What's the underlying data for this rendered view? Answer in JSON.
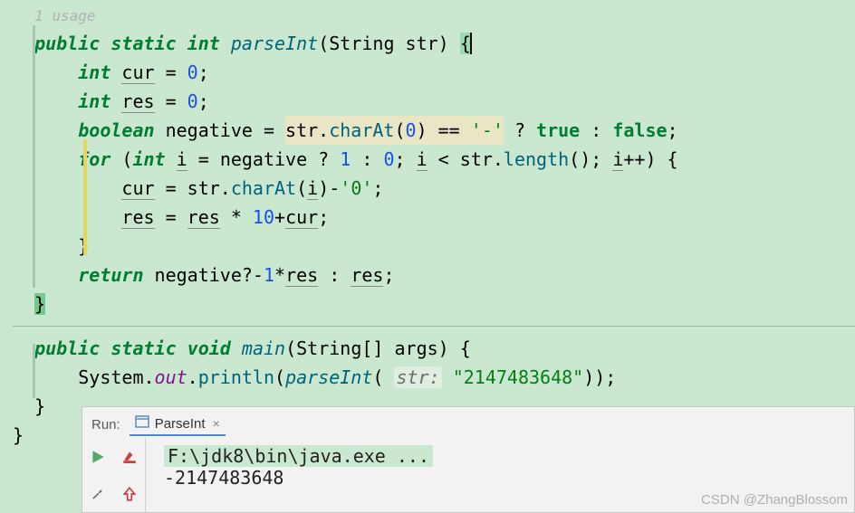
{
  "code": {
    "usage_hint": "1 usage",
    "tokens": {
      "public": "public",
      "static": "static",
      "int_kw": "int",
      "void_kw": "void",
      "boolean_kw": "boolean",
      "for": "for",
      "return": "return",
      "true": "true",
      "false": "false"
    },
    "method1": {
      "name": "parseInt",
      "param_type": "String",
      "param_name": "str",
      "body": {
        "line_cur_decl": {
          "type": "int",
          "var": "cur",
          "init": "0"
        },
        "line_res_decl": {
          "type": "int",
          "var": "res",
          "init": "0"
        },
        "line_neg": {
          "type": "boolean",
          "var": "negative",
          "expr_obj": "str",
          "expr_fn": "charAt",
          "expr_arg": "0",
          "eq_char": "'-'",
          "tern_true": "true",
          "tern_false": "false"
        },
        "for_line": {
          "type": "int",
          "var": "i",
          "init_cond": "negative",
          "init_then": "1",
          "init_else": "0",
          "cond_var": "i",
          "cond_obj": "str",
          "cond_fn": "length",
          "inc_var": "i"
        },
        "for_body": {
          "line1_lhs": "cur",
          "line1_obj": "str",
          "line1_fn": "charAt",
          "line1_arg": "i",
          "line1_sub": "'0'",
          "line2_lhs": "res",
          "line2_rhs_a": "res",
          "line2_mul": "10",
          "line2_add": "cur"
        },
        "return_line": {
          "cond": "negative",
          "then_expr": "-1*res",
          "else_var": "res"
        }
      }
    },
    "method2": {
      "name": "main",
      "param_type": "String[]",
      "param_name": "args",
      "println_obj": "System",
      "println_field": "out",
      "println_fn": "println",
      "call_fn": "parseInt",
      "hint_label": "str:",
      "arg_str": "\"2147483648\""
    }
  },
  "run": {
    "label": "Run:",
    "tab_name": "ParseInt",
    "output_cmd": "F:\\jdk8\\bin\\java.exe ...",
    "output_line": "-2147483648"
  },
  "watermark": "CSDN @ZhangBlossom",
  "icons": {
    "play": "play-icon",
    "wrench": "wrench-icon",
    "red_underline": "stop-edit-icon",
    "up_arrow": "up-arrow-icon",
    "window": "window-icon",
    "close": "close-icon"
  }
}
